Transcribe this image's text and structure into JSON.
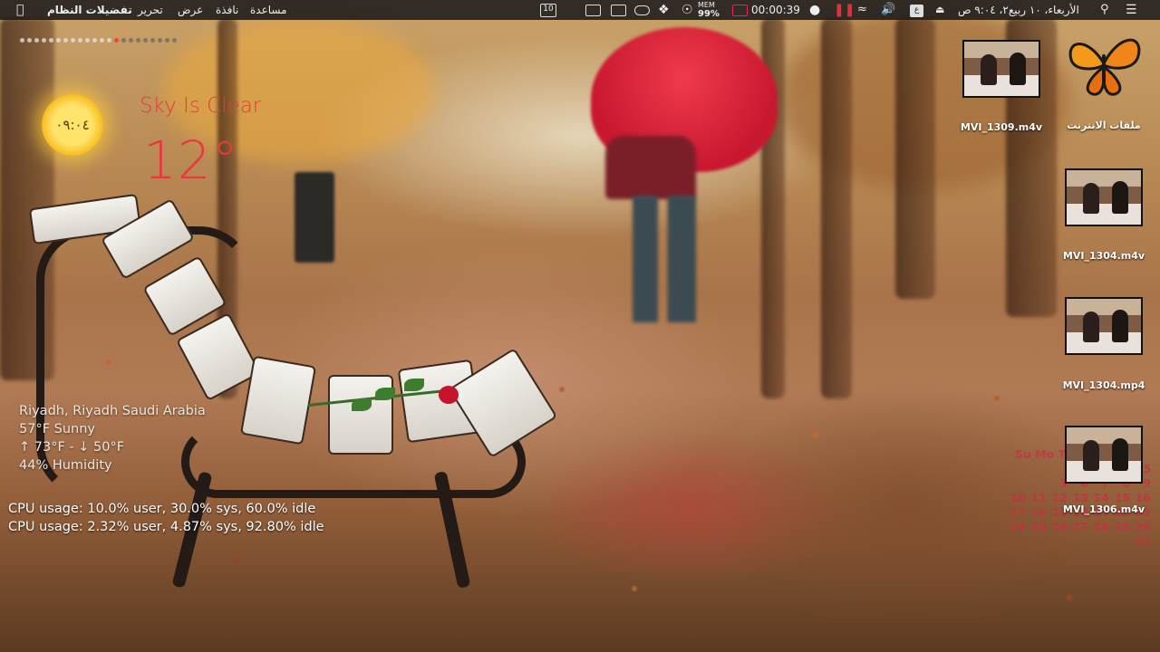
{
  "menubar": {
    "apple_icon": "apple-logo-icon",
    "menus": [
      "مساعدة",
      "نافذة",
      "عرض",
      "تحرير",
      "تفضيلات النظام"
    ],
    "status": {
      "calendar_badge": "10",
      "memory_label": "MEM",
      "memory_value": "99%",
      "timer": "00:00:39",
      "datetime": "الأربعاء، ١٠ ربيع٢، ٩:٠٤ ص"
    }
  },
  "weather": {
    "sun_time": "٠٩:٠٤",
    "condition": "Sky Is Clear",
    "temperature": "12°",
    "location": "Riyadh, Riyadh Saudi Arabia",
    "current": "57°F  Sunny",
    "range": "↑ 73°F - ↓ 50°F",
    "humidity": "44%  Humidity",
    "page_dots_total": 22,
    "page_dots_active": 13
  },
  "cpu": {
    "line1": "CPU usage: 10.0% user, 30.0% sys, 60.0% idle",
    "line2": "CPU usage: 2.32% user, 4.87% sys, 92.80% idle"
  },
  "desktop_files": [
    {
      "name": "MVI_1309.m4v"
    },
    {
      "name": "ملفات الانترنت"
    },
    {
      "name": "MVI_1304.m4v"
    },
    {
      "name": "MVI_1304.mp4"
    },
    {
      "name": "MVI_1306.m4v"
    }
  ],
  "calendar": {
    "header": "Su Mo Tu",
    "rows": [
      [
        "5"
      ],
      [
        "3",
        "6",
        "7",
        "8",
        "9"
      ],
      [
        "10",
        "11",
        "12",
        "13",
        "14",
        "15",
        "16"
      ],
      [
        "17",
        "18",
        "19",
        "20",
        "21",
        "22",
        "23"
      ],
      [
        "24",
        "25",
        "26",
        "27",
        "28",
        "29",
        "30"
      ],
      [
        "31"
      ]
    ]
  },
  "colors": {
    "menubar_bg": "#1c1a1c",
    "weather_accent": "#e8393f",
    "sun_yellow": "#ffd84a"
  }
}
